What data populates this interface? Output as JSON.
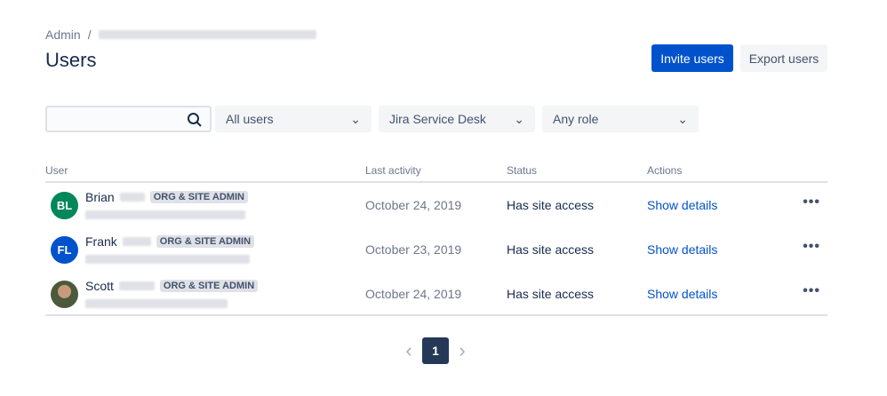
{
  "breadcrumb": {
    "root": "Admin",
    "separator": "/"
  },
  "page_title": "Users",
  "actions": {
    "invite": "Invite users",
    "export": "Export users"
  },
  "filters": {
    "search_placeholder": "",
    "users": "All users",
    "product": "Jira Service Desk",
    "role": "Any role"
  },
  "table": {
    "headers": [
      "User",
      "Last activity",
      "Status",
      "Actions"
    ],
    "rows": [
      {
        "initials": "BL",
        "first_name": "Brian",
        "badge": "ORG & SITE ADMIN",
        "last_activity": "October 24, 2019",
        "status": "Has site access",
        "action": "Show details",
        "avatar_color": "#00875a"
      },
      {
        "initials": "FL",
        "first_name": "Frank",
        "badge": "ORG & SITE ADMIN",
        "last_activity": "October 23, 2019",
        "status": "Has site access",
        "action": "Show details",
        "avatar_color": "#0052cc"
      },
      {
        "initials": "",
        "first_name": "Scott",
        "badge": "ORG & SITE ADMIN",
        "last_activity": "October 24, 2019",
        "status": "Has site access",
        "action": "Show details",
        "avatar_color": "#5e6c4a"
      }
    ]
  },
  "pagination": {
    "current": "1",
    "prev": "‹",
    "next": "›"
  }
}
